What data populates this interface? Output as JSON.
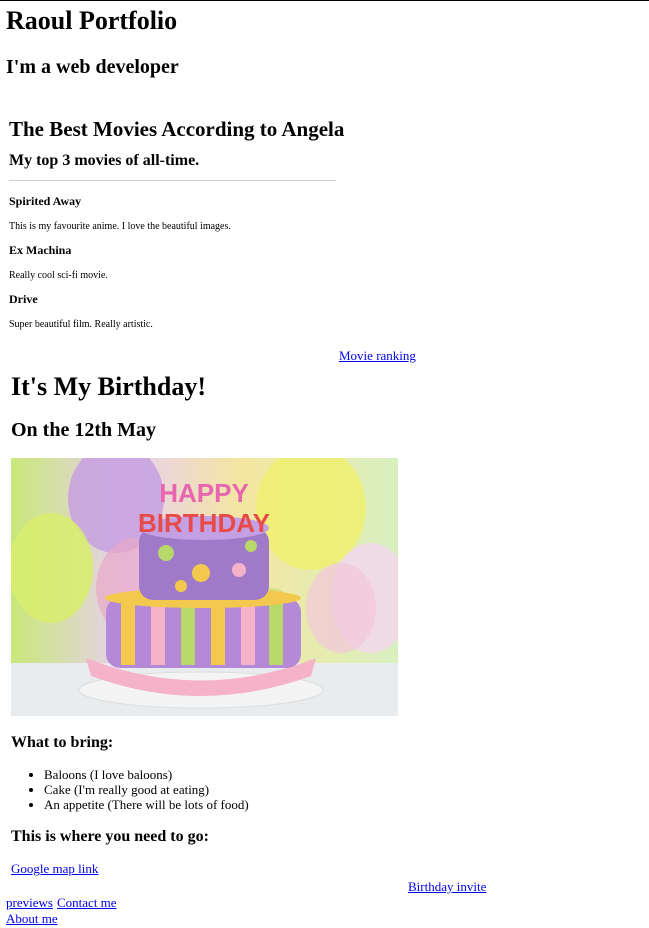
{
  "header": {
    "title": "Raoul Portfolio",
    "subtitle": "I'm a web developer"
  },
  "movies": {
    "title": "The Best Movies According to Angela",
    "subtitle": "My top 3 movies of all-time.",
    "items": [
      {
        "name": "Spirited Away",
        "description": "This is my favourite anime. I love the beautiful images."
      },
      {
        "name": "Ex Machina",
        "description": "Really cool sci-fi movie."
      },
      {
        "name": "Drive",
        "description": "Super beautiful film. Really artistic."
      }
    ],
    "link_label": "Movie ranking"
  },
  "birthday": {
    "title": "It's My Birthday!",
    "date": "On the 12th May",
    "cake_image": {
      "topper_line1": "HAPPY",
      "topper_line2": "BIRTHDAY",
      "colors": {
        "purple": "#b48ad8",
        "yellow": "#f2c94c",
        "pink": "#f5b3c9",
        "green": "#b8d86a"
      }
    },
    "bring_heading": "What to bring:",
    "bring_items": [
      "Baloons (I love baloons)",
      "Cake (I'm really good at eating)",
      "An appetite (There will be lots of food)"
    ],
    "go_heading": "This is where you need to go:",
    "map_link_label": "Google map link",
    "invite_link_label": "Birthday invite"
  },
  "nav": {
    "previews_label": "previews",
    "contact_label": "Contact me",
    "about_label": "About me"
  }
}
